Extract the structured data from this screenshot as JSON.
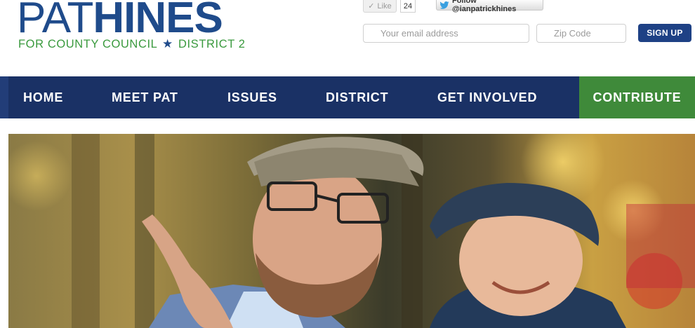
{
  "logo": {
    "first_name": "PAT",
    "last_name": "HINES",
    "tagline_left": "FOR COUNTY COUNCIL",
    "tagline_right": "DISTRICT 2"
  },
  "social": {
    "like_label": "Like",
    "like_count": "24",
    "follow_label": "Follow @ianpatrickhines"
  },
  "signup": {
    "email_placeholder": "Your email address",
    "zip_placeholder": "Zip Code",
    "button_label": "SIGN UP"
  },
  "nav": {
    "items": [
      "HOME",
      "MEET PAT",
      "ISSUES",
      "DISTRICT",
      "GET INVOLVED"
    ],
    "contribute": "CONTRIBUTE"
  },
  "colors": {
    "brand_blue": "#1f4b8b",
    "nav_blue": "#1a3165",
    "brand_green": "#3f8a3a"
  }
}
